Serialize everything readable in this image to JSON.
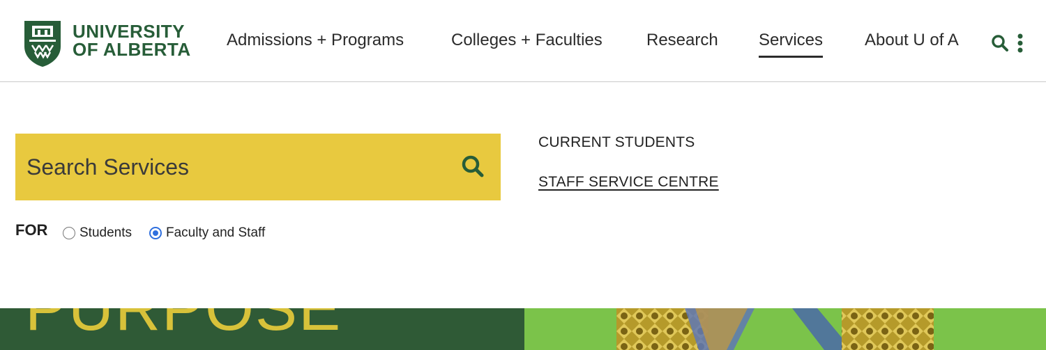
{
  "brand": {
    "line1": "UNIVERSITY",
    "line2": "OF ALBERTA",
    "color": "#275d38"
  },
  "nav": {
    "items": [
      {
        "label": "Admissions + Programs"
      },
      {
        "label": "Colleges + Faculties"
      },
      {
        "label": "Research"
      },
      {
        "label": "Services",
        "active": true
      },
      {
        "label": "About U of A"
      }
    ]
  },
  "header_icons": [
    "search-icon",
    "more-vertical-icon"
  ],
  "search": {
    "placeholder": "Search Services",
    "background": "#e8c93f"
  },
  "audience": {
    "label": "FOR",
    "options": [
      {
        "label": "Students",
        "checked": false
      },
      {
        "label": "Faculty and Staff",
        "checked": true
      }
    ]
  },
  "links": {
    "current_students": "CURRENT STUDENTS",
    "staff_service_centre": "STAFF SERVICE CENTRE"
  },
  "hero": {
    "word": "PURPOSE",
    "left_color": "#2f5a36",
    "right_color": "#7bc34a"
  }
}
